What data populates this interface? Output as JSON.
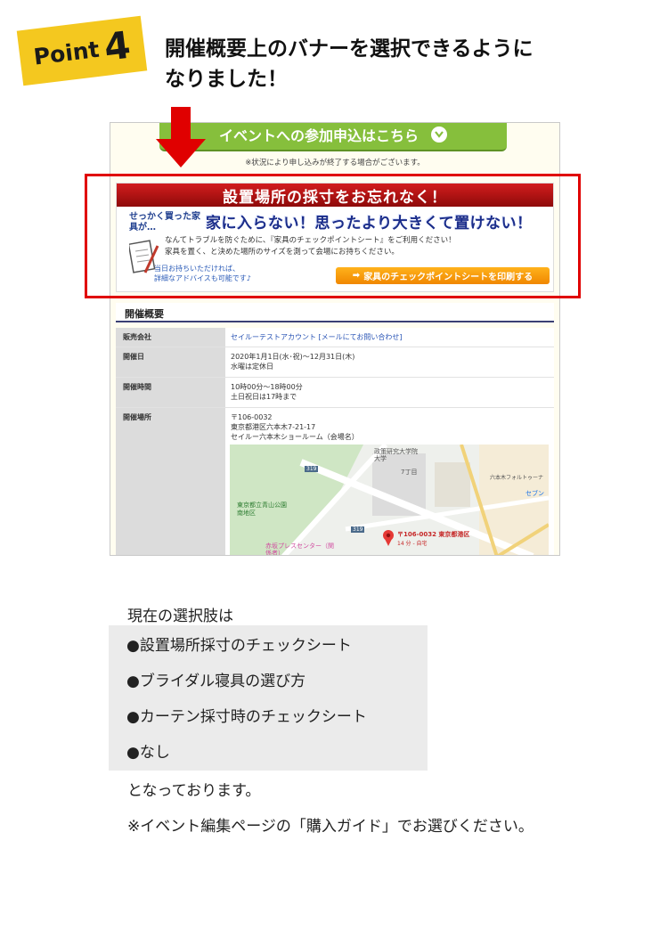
{
  "badge": {
    "word": "Point",
    "number": "4"
  },
  "headline": {
    "line1": "開催概要上のバナーを選択できるように",
    "line2": "なりました！"
  },
  "screenshot": {
    "apply_button_label": "イベントへの参加申込はこちら",
    "apply_note": "※状況により申し込みが終了する場合がございます。",
    "banner": {
      "title": "設置場所の採寸をお忘れなく！",
      "sub_small": "せっかく買った家具が…",
      "catch": "家に入らない！思ったより大きくて置けない！",
      "desc_line1": "なんてトラブルを防ぐために、『家具のチェックポイントシート』をご利用ください！",
      "desc_line2": "家具を置く、と決めた場所のサイズを測って会場にお持ちください。",
      "advice_line1": "当日お持ちいただければ、",
      "advice_line2": "詳細なアドバイスも可能です♪",
      "print_button_label": "家具のチェックポイントシートを印刷する"
    },
    "section_title": "開催概要",
    "table": [
      {
        "key": "販売会社",
        "value_link": "セイルーテストアカウント",
        "value_extra": "[メールにてお問い合わせ]"
      },
      {
        "key": "開催日",
        "line1": "2020年1月1日(水･祝)〜12月31日(木)",
        "line2": "水曜は定休日"
      },
      {
        "key": "開催時間",
        "line1": "10時00分〜18時00分",
        "line2": "土日祝日は17時まで"
      },
      {
        "key": "開催場所",
        "line1": "〒106-0032",
        "line2": "東京都港区六本木7-21-17",
        "line3": "セイルー六本木ショールーム（会場名）"
      }
    ],
    "map": {
      "labels": {
        "university": "政策研究大学院大学",
        "chome": "7丁目",
        "park": "東京都立青山公園南地区",
        "roppongi": "六本木フォルトゥーナ",
        "route319": "319",
        "route319b": "319",
        "akasaka": "赤坂プレスセンター（関係者）",
        "pin_label": "〒106-0032 東京都港区",
        "pin_sub": "14 分 - 自宅",
        "seven": "セブン"
      }
    }
  },
  "intro": "現在の選択肢は",
  "choices": [
    "●設置場所採寸のチェックシート",
    "●ブライダル寝具の選び方",
    "●カーテン採寸時のチェックシート",
    "●なし"
  ],
  "tail1": "となっております。",
  "tail2": "※イベント編集ページの「購入ガイド」でお選びください。"
}
